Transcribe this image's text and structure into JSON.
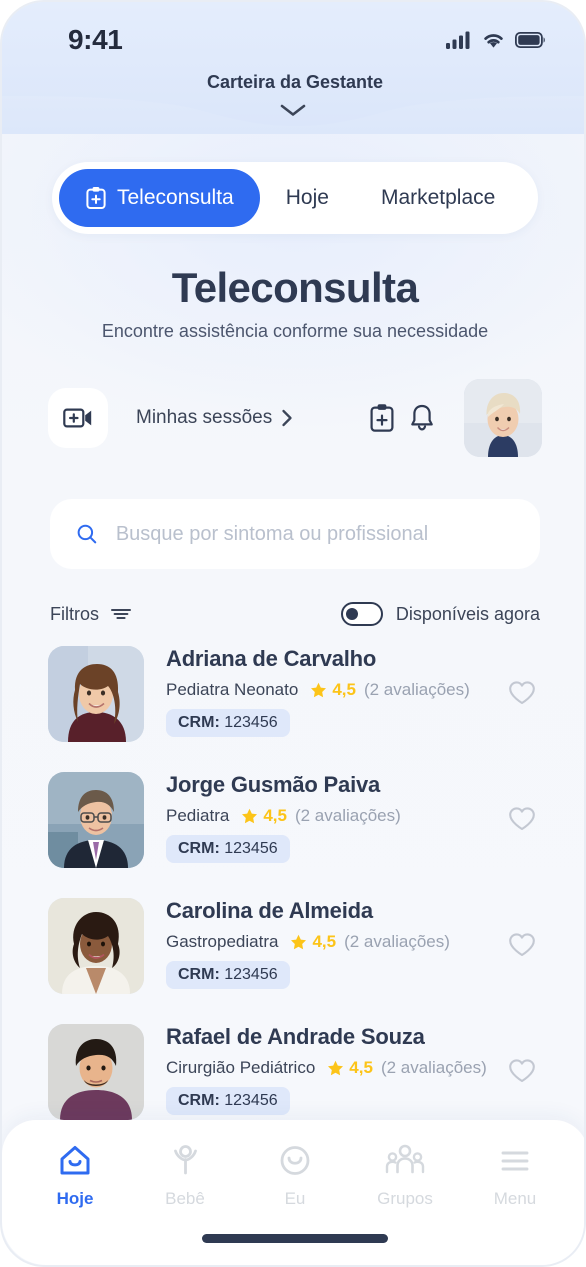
{
  "statusbar": {
    "time": "9:41",
    "signal_icon": "cellular-signal-icon",
    "wifi_icon": "wifi-icon",
    "battery_icon": "battery-icon"
  },
  "header": {
    "title": "Carteira da Gestante",
    "collapse_icon": "chevron-down-icon"
  },
  "tabs": {
    "items": [
      {
        "label": "Teleconsulta",
        "icon": "clipboard-plus-icon",
        "active": true
      },
      {
        "label": "Hoje",
        "icon": "",
        "active": false
      },
      {
        "label": "Marketplace",
        "icon": "",
        "active": false
      }
    ]
  },
  "hero": {
    "title": "Teleconsulta",
    "subtitle": "Encontre assistência conforme sua necessidade"
  },
  "actions": {
    "new_session_icon": "video-plus-icon",
    "sessions_label": "Minhas sessões",
    "sessions_chevron_icon": "chevron-right-icon",
    "records_icon": "clipboard-plus-icon",
    "notifications_icon": "bell-icon",
    "avatar_icon": "user-avatar"
  },
  "search": {
    "icon": "search-icon",
    "value": "",
    "placeholder": "Busque por sintoma ou profissional"
  },
  "filters": {
    "label": "Filtros",
    "icon": "filter-sliders-icon",
    "available_now_label": "Disponíveis agora",
    "available_now_on": false
  },
  "doctors": [
    {
      "name": "Adriana de Carvalho",
      "specialty": "Pediatra Neonato",
      "rating": "4,5",
      "reviews": "(2 avaliações)",
      "crm_label": "CRM:",
      "crm_value": "123456",
      "favorite": false,
      "favorite_icon": "heart-outline-icon",
      "star_icon": "star-icon"
    },
    {
      "name": "Jorge Gusmão Paiva",
      "specialty": "Pediatra",
      "rating": "4,5",
      "reviews": "(2 avaliações)",
      "crm_label": "CRM:",
      "crm_value": "123456",
      "favorite": false,
      "favorite_icon": "heart-outline-icon",
      "star_icon": "star-icon"
    },
    {
      "name": "Carolina de Almeida",
      "specialty": "Gastropediatra",
      "rating": "4,5",
      "reviews": "(2 avaliações)",
      "crm_label": "CRM:",
      "crm_value": "123456",
      "favorite": false,
      "favorite_icon": "heart-outline-icon",
      "star_icon": "star-icon"
    },
    {
      "name": "Rafael de Andrade Souza",
      "specialty": "Cirurgião Pediátrico",
      "rating": "4,5",
      "reviews": "(2 avaliações)",
      "crm_label": "CRM:",
      "crm_value": "123456",
      "favorite": false,
      "favorite_icon": "heart-outline-icon",
      "star_icon": "star-icon"
    }
  ],
  "bottom_nav": {
    "items": [
      {
        "label": "Hoje",
        "icon": "home-icon",
        "active": true
      },
      {
        "label": "Bebê",
        "icon": "baby-icon",
        "active": false
      },
      {
        "label": "Eu",
        "icon": "smiley-face-icon",
        "active": false
      },
      {
        "label": "Grupos",
        "icon": "people-group-icon",
        "active": false
      },
      {
        "label": "Menu",
        "icon": "hamburger-menu-icon",
        "active": false
      }
    ]
  },
  "colors": {
    "accent": "#2f6bf0",
    "star": "#fcc419",
    "text": "#2f3a52",
    "muted": "#9aa2b1",
    "badge_bg": "#dfe8fa",
    "header_bg": "#e2ebfb"
  }
}
